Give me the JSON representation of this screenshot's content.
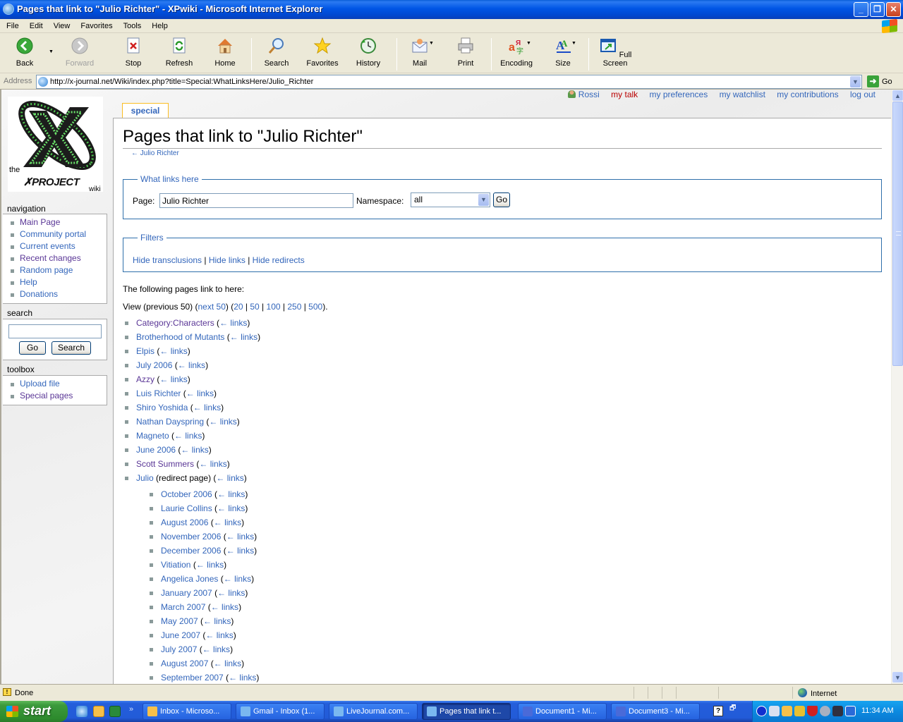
{
  "window": {
    "title": "Pages that link to \"Julio Richter\" - XPwiki - Microsoft Internet Explorer",
    "controls": [
      "minimize",
      "restore",
      "close"
    ]
  },
  "menu": [
    "File",
    "Edit",
    "View",
    "Favorites",
    "Tools",
    "Help"
  ],
  "toolbar": {
    "back": "Back",
    "forward": "Forward",
    "stop": "Stop",
    "refresh": "Refresh",
    "home": "Home",
    "search": "Search",
    "favorites": "Favorites",
    "history": "History",
    "mail": "Mail",
    "print": "Print",
    "encoding": "Encoding",
    "size": "Size",
    "fullscreen": "Full Screen"
  },
  "address": {
    "label": "Address",
    "url": "http://x-journal.net/Wiki/index.php?title=Special:WhatLinksHere/Julio_Richter",
    "go": "Go"
  },
  "logo": {
    "the": "the",
    "project": "PROJECT",
    "wiki": "wiki"
  },
  "personal": {
    "user": "Rossi",
    "talk": "my talk",
    "preferences": "my preferences",
    "watchlist": "my watchlist",
    "contributions": "my contributions",
    "logout": "log out"
  },
  "sidebar": {
    "navigation": {
      "title": "navigation",
      "items": [
        {
          "label": "Main Page",
          "visited": true
        },
        {
          "label": "Community portal",
          "visited": false
        },
        {
          "label": "Current events",
          "visited": false
        },
        {
          "label": "Recent changes",
          "visited": true
        },
        {
          "label": "Random page",
          "visited": false
        },
        {
          "label": "Help",
          "visited": false
        },
        {
          "label": "Donations",
          "visited": false
        }
      ]
    },
    "search": {
      "title": "search",
      "value": "",
      "go": "Go",
      "search": "Search"
    },
    "toolbox": {
      "title": "toolbox",
      "items": [
        {
          "label": "Upload file",
          "visited": false
        },
        {
          "label": "Special pages",
          "visited": true
        }
      ]
    }
  },
  "tab": "special",
  "page": {
    "title": "Pages that link to \"Julio Richter\"",
    "backlink": "← Julio Richter",
    "whatlinks": {
      "legend": "What links here",
      "page_label": "Page:",
      "page_value": "Julio Richter",
      "namespace_label": "Namespace:",
      "namespace_value": "all",
      "go": "Go"
    },
    "filters": {
      "legend": "Filters",
      "items": [
        "Hide transclusions",
        "Hide links",
        "Hide redirects"
      ],
      "sep": " | "
    },
    "intro": "The following pages link to here:",
    "view": {
      "prefix": "View (previous 50) (",
      "next": "next 50",
      "mid": ") (",
      "limits": [
        "20",
        "50",
        "100",
        "250",
        "500"
      ],
      "suffix": ")."
    },
    "links_label": "← links",
    "results": [
      {
        "title": "Category:Characters",
        "visited": true
      },
      {
        "title": "Brotherhood of Mutants",
        "visited": false
      },
      {
        "title": "Elpis",
        "visited": false
      },
      {
        "title": "July 2006",
        "visited": false
      },
      {
        "title": "Azzy",
        "visited": true
      },
      {
        "title": "Luis Richter",
        "visited": false
      },
      {
        "title": "Shiro Yoshida",
        "visited": false
      },
      {
        "title": "Nathan Dayspring",
        "visited": false
      },
      {
        "title": "Magneto",
        "visited": false
      },
      {
        "title": "June 2006",
        "visited": false
      },
      {
        "title": "Scott Summers",
        "visited": true
      },
      {
        "title": "Julio",
        "visited": false,
        "note": "(redirect page)"
      }
    ],
    "redirect_results": [
      "October 2006",
      "Laurie Collins",
      "August 2006",
      "November 2006",
      "December 2006",
      "Vitiation",
      "Angelica Jones",
      "January 2007",
      "March 2007",
      "May 2007",
      "June 2007",
      "July 2007",
      "August 2007",
      "September 2007"
    ]
  },
  "status": {
    "text": "Done",
    "zone": "Internet"
  },
  "taskbar": {
    "start": "start",
    "buttons": [
      {
        "label": "Inbox - Microso...",
        "active": false
      },
      {
        "label": "Gmail - Inbox (1...",
        "active": false
      },
      {
        "label": "LiveJournal.com...",
        "active": false
      },
      {
        "label": "Pages that link t...",
        "active": true
      },
      {
        "label": "Document1 - Mi...",
        "active": false
      },
      {
        "label": "Document3 - Mi...",
        "active": false
      }
    ],
    "clock": "11:34 AM"
  },
  "colors": {
    "link": "#3366bb",
    "visited": "#5a3696",
    "new": "#ba0000",
    "tab_border": "#fabd23",
    "fieldset_border": "#2f6fab"
  }
}
